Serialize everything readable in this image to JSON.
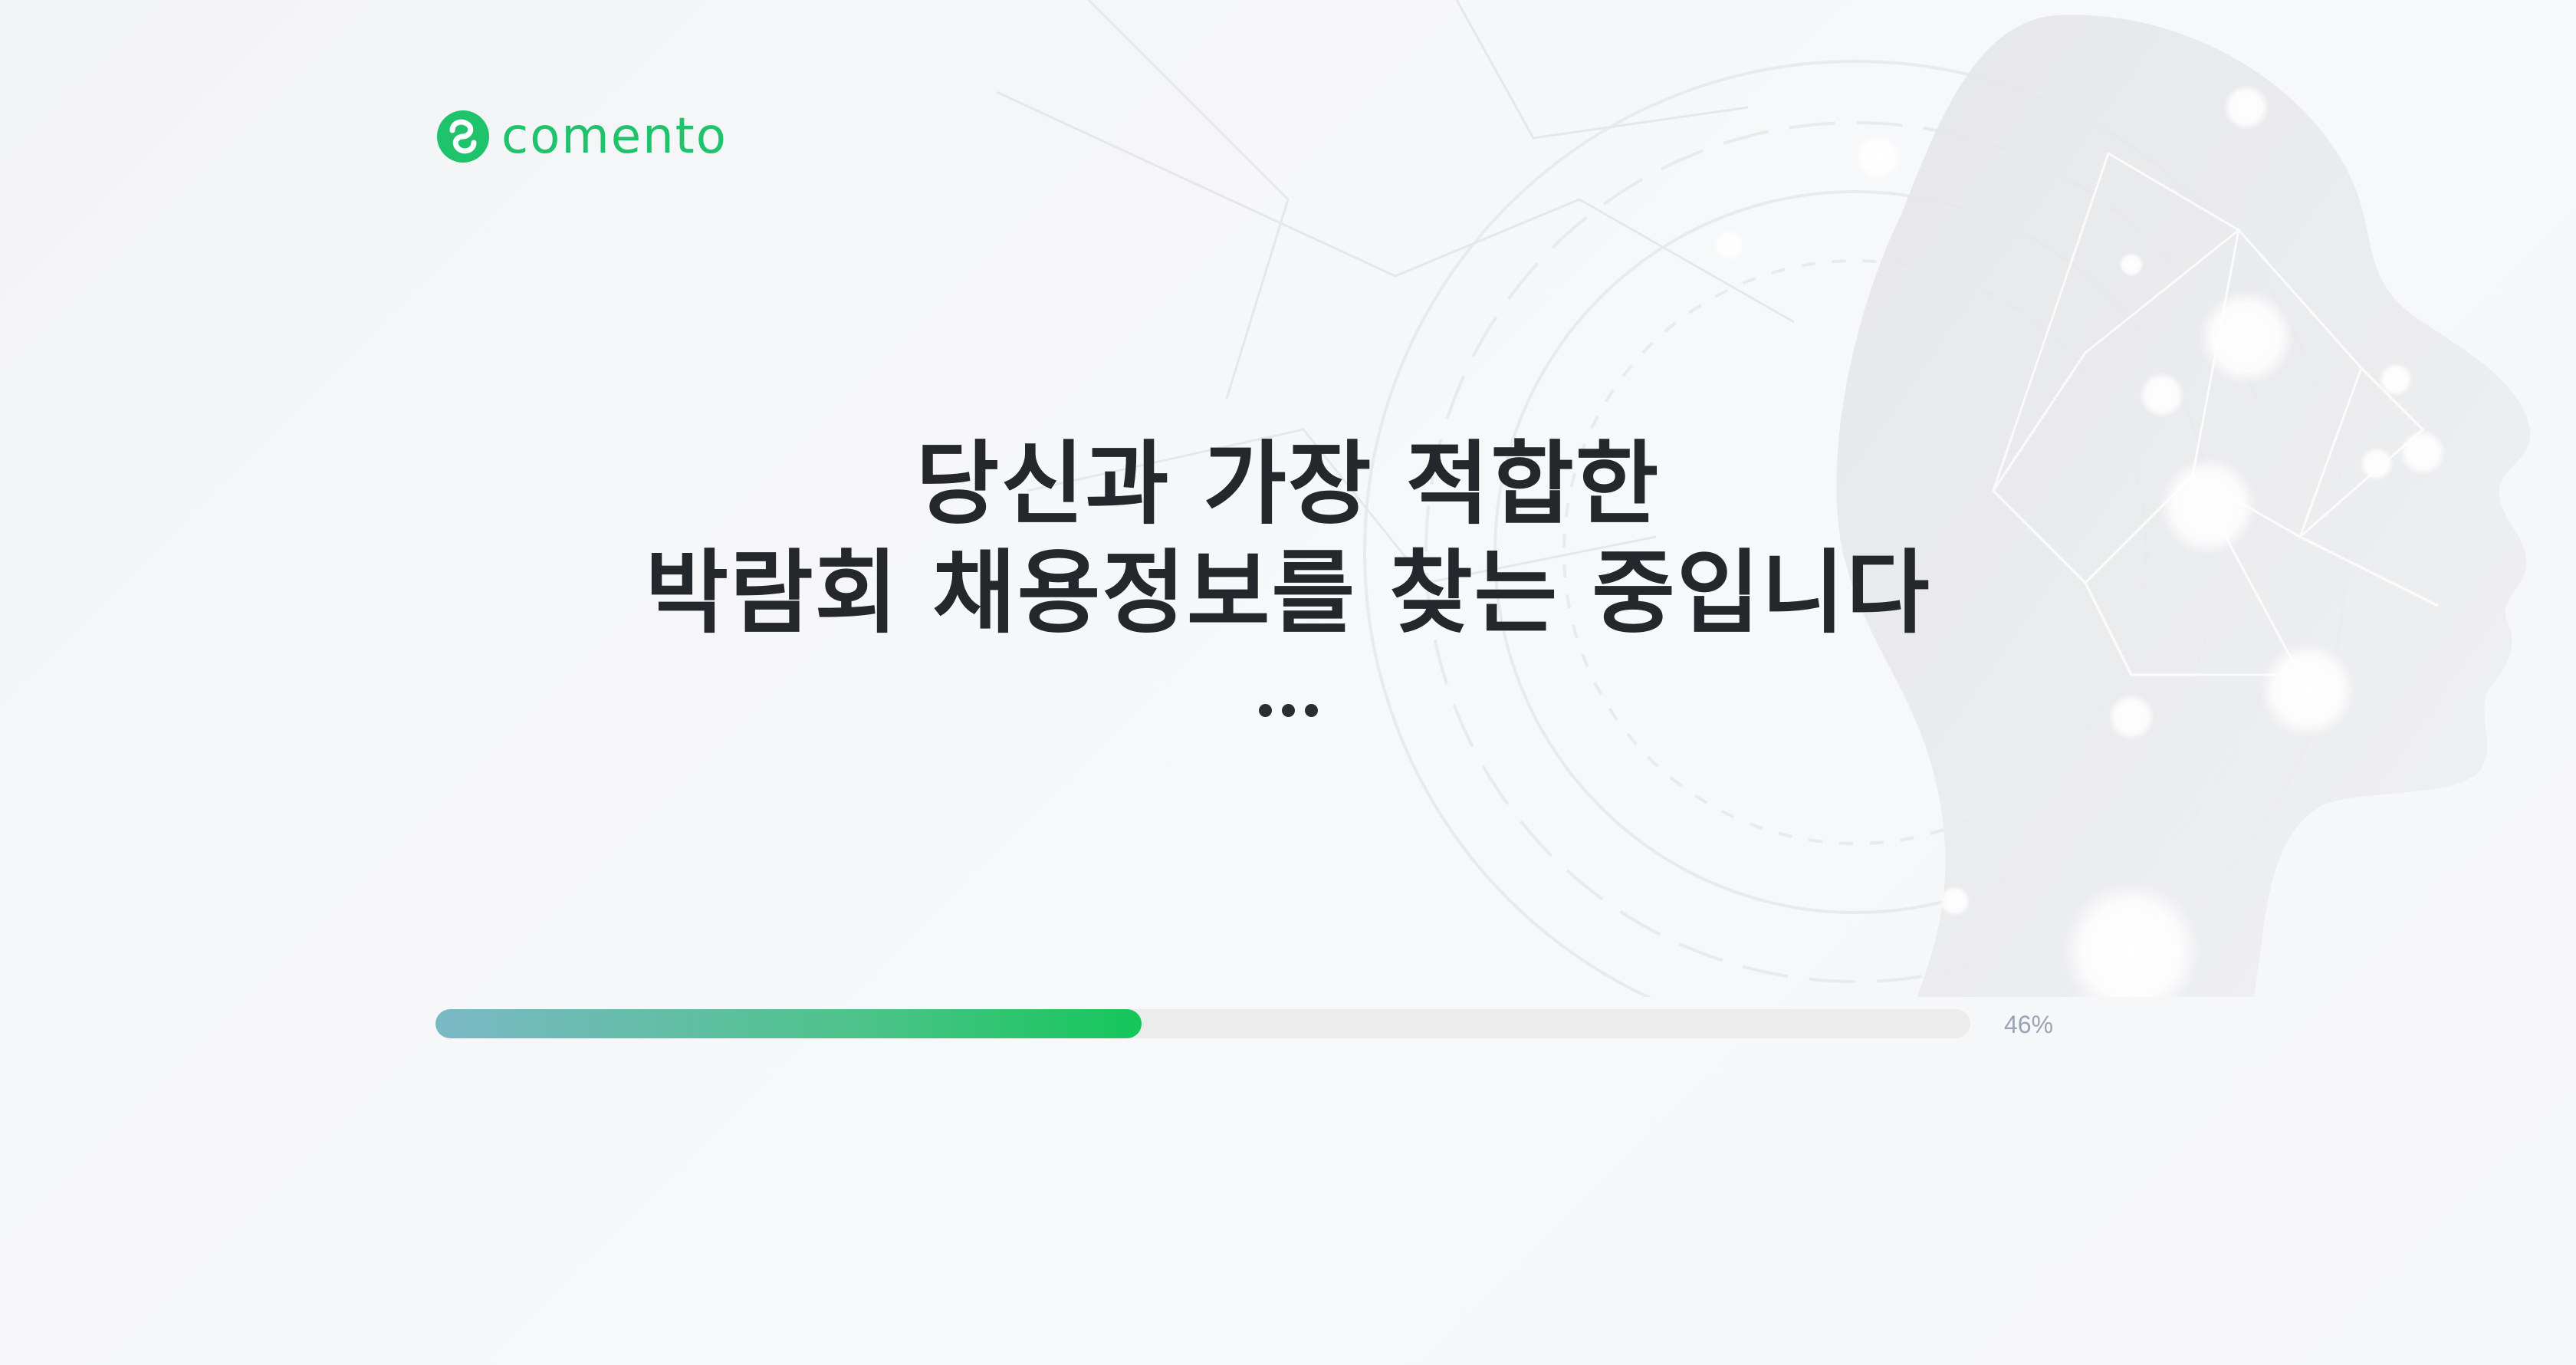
{
  "brand": {
    "name": "comento",
    "color": "#1fc36b"
  },
  "headline": {
    "line1": "당신과 가장 적합한",
    "line2": "박람회 채용정보를 찾는 중입니다",
    "ellipsis": "..."
  },
  "progress": {
    "value": 0.46,
    "label": "46%",
    "fill_start_color": "#7bb8c6",
    "fill_end_color": "#14c65a"
  },
  "background": {
    "illustration": "ai-head-network-icon"
  }
}
